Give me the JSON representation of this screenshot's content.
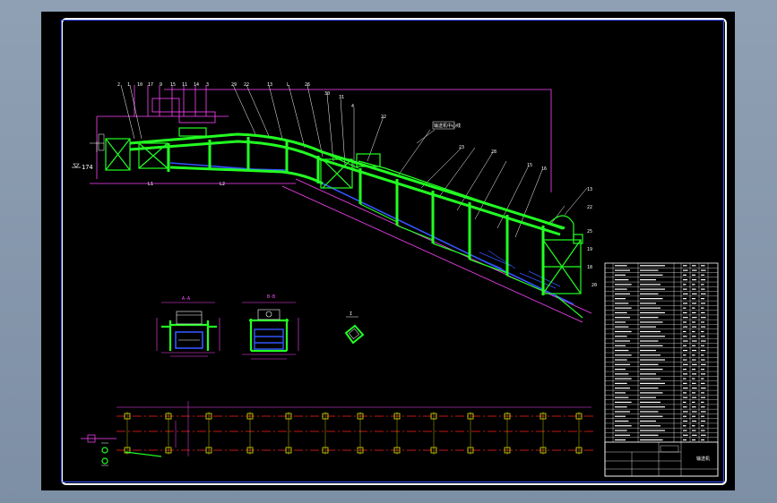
{
  "drawing": {
    "elevation_label": "174",
    "center_callout": "输送机中心线",
    "section_a_label": "A-A",
    "section_b_label": "B-B",
    "detail_label": "I",
    "title_block_name": "输送机"
  },
  "colors": {
    "frame_green": "#22ff22",
    "dim_magenta": "#ff44ff",
    "belt_blue": "#3355ff",
    "axis_red": "#ff2222",
    "column_yellow": "#e6e600",
    "sheet_border": "#3a55ff",
    "background": "#000000"
  },
  "parts_table": {
    "row_count": 38
  }
}
